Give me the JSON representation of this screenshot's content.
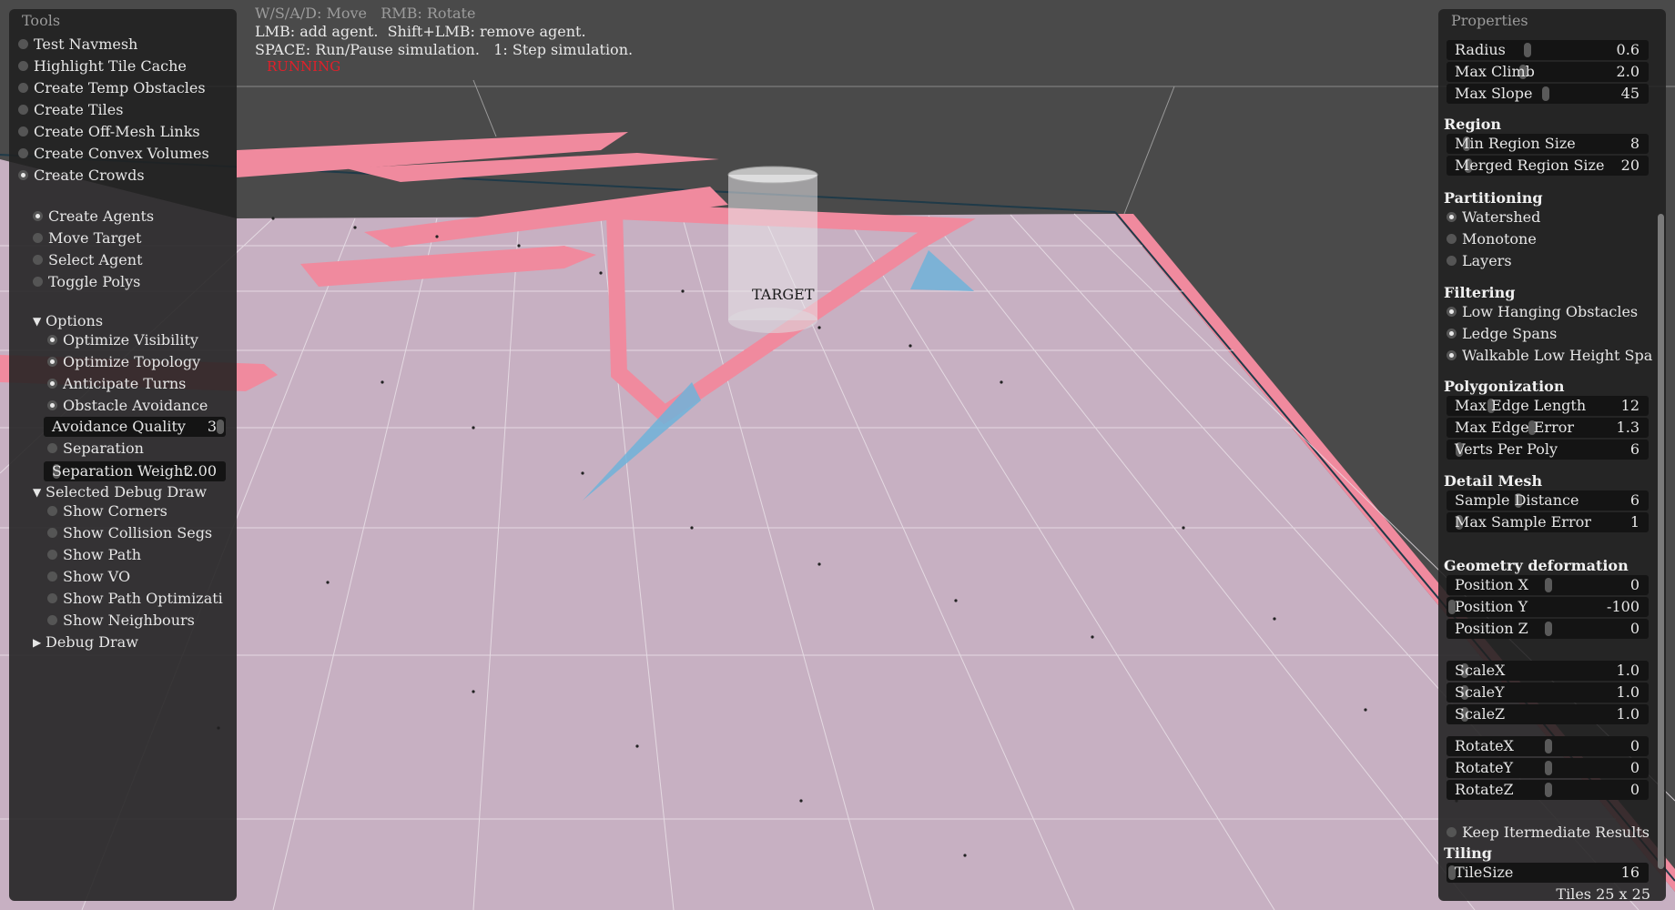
{
  "hints": {
    "line1": "W/S/A/D: Move   RMB: Rotate",
    "line2": "LMB: add agent.  Shift+LMB: remove agent.",
    "line3": "SPACE: Run/Pause simulation.   1: Step simulation.",
    "status": "RUNNING"
  },
  "scene": {
    "target_label": "TARGET"
  },
  "tools": {
    "title": "Tools",
    "items": [
      {
        "label": "Test Navmesh",
        "on": false
      },
      {
        "label": "Highlight Tile Cache",
        "on": false
      },
      {
        "label": "Create Temp Obstacles",
        "on": false
      },
      {
        "label": "Create Tiles",
        "on": false
      },
      {
        "label": "Create Off-Mesh Links",
        "on": false
      },
      {
        "label": "Create Convex Volumes",
        "on": false
      },
      {
        "label": "Create Crowds",
        "on": true
      }
    ],
    "modes": [
      {
        "label": "Create Agents",
        "on": true
      },
      {
        "label": "Move Target",
        "on": false
      },
      {
        "label": "Select Agent",
        "on": false
      },
      {
        "label": "Toggle Polys",
        "on": false
      }
    ],
    "options_label": "Options",
    "options": [
      {
        "label": "Optimize Visibility",
        "on": true
      },
      {
        "label": "Optimize Topology",
        "on": true
      },
      {
        "label": "Anticipate Turns",
        "on": true
      },
      {
        "label": "Obstacle Avoidance",
        "on": true
      }
    ],
    "avoidance_quality": {
      "label": "Avoidance Quality",
      "value": "3"
    },
    "separation": {
      "label": "Separation",
      "on": false
    },
    "separation_weight": {
      "label": "Separation Weight",
      "value": "2.00"
    },
    "debug_label": "Selected Debug Draw",
    "debug_items": [
      {
        "label": "Show Corners",
        "on": false
      },
      {
        "label": "Show Collision Segs",
        "on": false
      },
      {
        "label": "Show Path",
        "on": false
      },
      {
        "label": "Show VO",
        "on": false
      },
      {
        "label": "Show Path Optimizati",
        "on": false
      },
      {
        "label": "Show Neighbours",
        "on": false
      }
    ],
    "debug_draw_label": "Debug Draw"
  },
  "props": {
    "title": "Properties",
    "agent": [
      {
        "label": "Radius",
        "value": "0.6"
      },
      {
        "label": "Max Climb",
        "value": "2.0"
      },
      {
        "label": "Max Slope",
        "value": "45"
      }
    ],
    "region_title": "Region",
    "region": [
      {
        "label": "Min Region Size",
        "value": "8"
      },
      {
        "label": "Merged Region Size",
        "value": "20"
      }
    ],
    "partitioning_title": "Partitioning",
    "partitioning": [
      {
        "label": "Watershed",
        "on": true
      },
      {
        "label": "Monotone",
        "on": false
      },
      {
        "label": "Layers",
        "on": false
      }
    ],
    "filtering_title": "Filtering",
    "filtering": [
      {
        "label": "Low Hanging Obstacles",
        "on": true
      },
      {
        "label": "Ledge Spans",
        "on": true
      },
      {
        "label": "Walkable Low Height Spa",
        "on": true
      }
    ],
    "polygonization_title": "Polygonization",
    "polygonization": [
      {
        "label": "Max Edge Length",
        "value": "12"
      },
      {
        "label": "Max Edge Error",
        "value": "1.3"
      },
      {
        "label": "Verts Per Poly",
        "value": "6"
      }
    ],
    "detail_title": "Detail Mesh",
    "detail": [
      {
        "label": "Sample Distance",
        "value": "6"
      },
      {
        "label": "Max Sample Error",
        "value": "1"
      }
    ],
    "geometry_title": "Geometry deformation",
    "position": [
      {
        "label": "Position X",
        "value": "0"
      },
      {
        "label": "Position Y",
        "value": "-100"
      },
      {
        "label": "Position Z",
        "value": "0"
      }
    ],
    "scale": [
      {
        "label": "ScaleX",
        "value": "1.0"
      },
      {
        "label": "ScaleY",
        "value": "1.0"
      },
      {
        "label": "ScaleZ",
        "value": "1.0"
      }
    ],
    "rotate": [
      {
        "label": "RotateX",
        "value": "0"
      },
      {
        "label": "RotateY",
        "value": "0"
      },
      {
        "label": "RotateZ",
        "value": "0"
      }
    ],
    "keep_results": {
      "label": "Keep Itermediate Results",
      "on": false
    },
    "tiling_title": "Tiling",
    "tilesize": {
      "label": "TileSize",
      "value": "16"
    },
    "tiles_info": "Tiles  25 x 25"
  }
}
